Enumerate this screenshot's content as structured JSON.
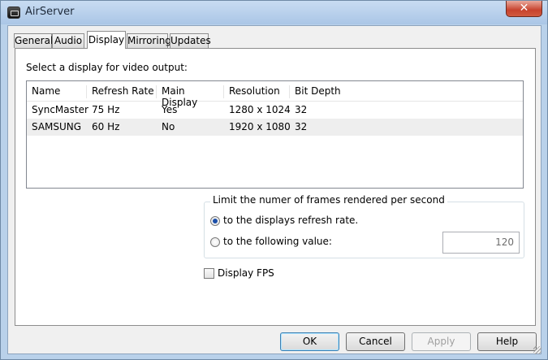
{
  "window": {
    "title": "AirServer",
    "close_glyph": "✕"
  },
  "tabs": [
    {
      "label": "General",
      "active": false
    },
    {
      "label": "Audio",
      "active": false
    },
    {
      "label": "Display",
      "active": true
    },
    {
      "label": "Mirroring",
      "active": false
    },
    {
      "label": "Updates",
      "active": false
    }
  ],
  "display": {
    "prompt": "Select a display for video output:",
    "columns": [
      "Name",
      "Refresh Rate",
      "Main Display",
      "Resolution",
      "Bit Depth"
    ],
    "rows": [
      [
        "SyncMaster",
        "75 Hz",
        "Yes",
        "1280 x 1024",
        "32"
      ],
      [
        "SAMSUNG",
        "60 Hz",
        "No",
        "1920 x 1080",
        "32"
      ]
    ],
    "fps_group": {
      "legend": "Limit the numer of frames rendered per second",
      "option_refresh": "to the displays refresh rate.",
      "option_value": "to the following value:",
      "selected": "refresh",
      "value": "120"
    },
    "display_fps": {
      "label": "Display FPS",
      "checked": false
    }
  },
  "buttons": {
    "ok": "OK",
    "cancel": "Cancel",
    "apply": "Apply",
    "help": "Help"
  },
  "icons": {
    "app": "airserver-app-icon",
    "close": "close-icon"
  }
}
